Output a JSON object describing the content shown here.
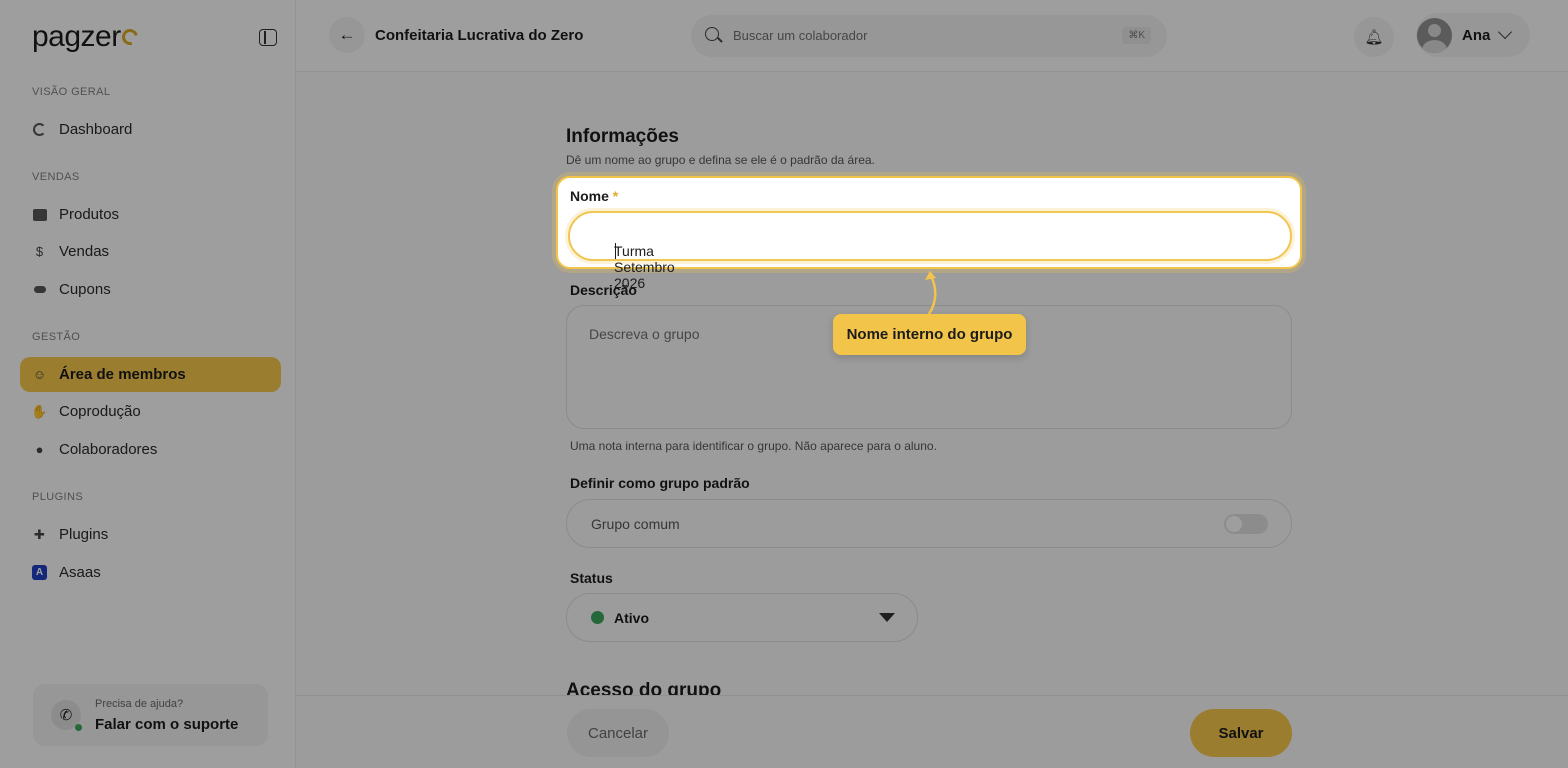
{
  "brand": {
    "logo_text": "pagzer",
    "accent": "#f3c44a"
  },
  "sidebar": {
    "sections": [
      {
        "label": "VISÃO GERAL"
      },
      {
        "label": "VENDAS"
      },
      {
        "label": "GESTÃO"
      },
      {
        "label": "PLUGINS"
      }
    ],
    "items": [
      {
        "label": "Dashboard",
        "icon": "dashboard-icon"
      },
      {
        "label": "Produtos",
        "icon": "products-icon"
      },
      {
        "label": "Vendas",
        "icon": "sales-icon"
      },
      {
        "label": "Cupons",
        "icon": "coupon-icon"
      },
      {
        "label": "Área de membros",
        "icon": "members-icon",
        "active": true
      },
      {
        "label": "Coprodução",
        "icon": "handshake-icon"
      },
      {
        "label": "Colaboradores",
        "icon": "user-icon"
      },
      {
        "label": "Plugins",
        "icon": "puzzle-icon"
      },
      {
        "label": "Asaas",
        "icon": "asaas-icon"
      }
    ],
    "help": {
      "small": "Precisa de ajuda?",
      "big": "Falar com o suporte"
    }
  },
  "topbar": {
    "title": "Confeitaria Lucrativa do Zero",
    "search_placeholder": "Buscar um colaborador",
    "search_shortcut": "⌘K",
    "user_name": "Ana"
  },
  "form": {
    "section_title": "Informações",
    "section_subtitle": "Dê um nome ao grupo e defina se ele é o padrão da área.",
    "name_label": "Nome",
    "name_required": "*",
    "name_value": "Turma Setembro 2026",
    "description_label": "Descrição",
    "description_placeholder": "Descreva o grupo",
    "description_hint": "Uma nota interna para identificar o grupo. Não aparece para o aluno.",
    "default_label": "Definir como grupo padrão",
    "default_text": "Grupo comum",
    "default_on": false,
    "status_label": "Status",
    "status_value": "Ativo",
    "status_color": "#3aa35b",
    "section2_title": "Acesso do grupo"
  },
  "footer": {
    "cancel": "Cancelar",
    "save": "Salvar"
  },
  "tooltip": {
    "text": "Nome interno do grupo"
  }
}
